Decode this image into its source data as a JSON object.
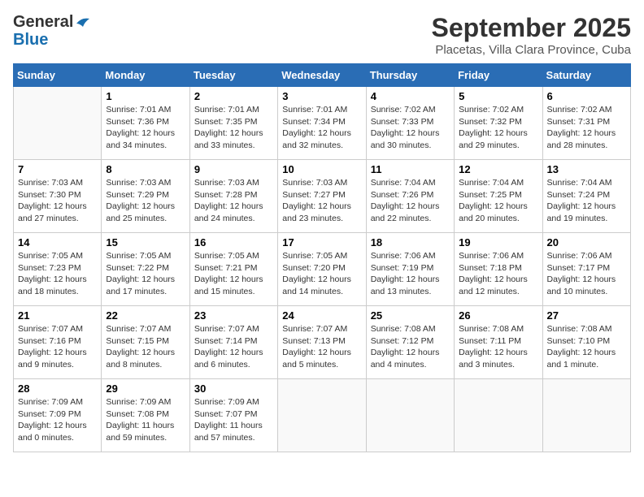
{
  "logo": {
    "general": "General",
    "blue": "Blue"
  },
  "title": "September 2025",
  "subtitle": "Placetas, Villa Clara Province, Cuba",
  "days_of_week": [
    "Sunday",
    "Monday",
    "Tuesday",
    "Wednesday",
    "Thursday",
    "Friday",
    "Saturday"
  ],
  "weeks": [
    [
      {
        "day": "",
        "info": ""
      },
      {
        "day": "1",
        "info": "Sunrise: 7:01 AM\nSunset: 7:36 PM\nDaylight: 12 hours\nand 34 minutes."
      },
      {
        "day": "2",
        "info": "Sunrise: 7:01 AM\nSunset: 7:35 PM\nDaylight: 12 hours\nand 33 minutes."
      },
      {
        "day": "3",
        "info": "Sunrise: 7:01 AM\nSunset: 7:34 PM\nDaylight: 12 hours\nand 32 minutes."
      },
      {
        "day": "4",
        "info": "Sunrise: 7:02 AM\nSunset: 7:33 PM\nDaylight: 12 hours\nand 30 minutes."
      },
      {
        "day": "5",
        "info": "Sunrise: 7:02 AM\nSunset: 7:32 PM\nDaylight: 12 hours\nand 29 minutes."
      },
      {
        "day": "6",
        "info": "Sunrise: 7:02 AM\nSunset: 7:31 PM\nDaylight: 12 hours\nand 28 minutes."
      }
    ],
    [
      {
        "day": "7",
        "info": "Sunrise: 7:03 AM\nSunset: 7:30 PM\nDaylight: 12 hours\nand 27 minutes."
      },
      {
        "day": "8",
        "info": "Sunrise: 7:03 AM\nSunset: 7:29 PM\nDaylight: 12 hours\nand 25 minutes."
      },
      {
        "day": "9",
        "info": "Sunrise: 7:03 AM\nSunset: 7:28 PM\nDaylight: 12 hours\nand 24 minutes."
      },
      {
        "day": "10",
        "info": "Sunrise: 7:03 AM\nSunset: 7:27 PM\nDaylight: 12 hours\nand 23 minutes."
      },
      {
        "day": "11",
        "info": "Sunrise: 7:04 AM\nSunset: 7:26 PM\nDaylight: 12 hours\nand 22 minutes."
      },
      {
        "day": "12",
        "info": "Sunrise: 7:04 AM\nSunset: 7:25 PM\nDaylight: 12 hours\nand 20 minutes."
      },
      {
        "day": "13",
        "info": "Sunrise: 7:04 AM\nSunset: 7:24 PM\nDaylight: 12 hours\nand 19 minutes."
      }
    ],
    [
      {
        "day": "14",
        "info": "Sunrise: 7:05 AM\nSunset: 7:23 PM\nDaylight: 12 hours\nand 18 minutes."
      },
      {
        "day": "15",
        "info": "Sunrise: 7:05 AM\nSunset: 7:22 PM\nDaylight: 12 hours\nand 17 minutes."
      },
      {
        "day": "16",
        "info": "Sunrise: 7:05 AM\nSunset: 7:21 PM\nDaylight: 12 hours\nand 15 minutes."
      },
      {
        "day": "17",
        "info": "Sunrise: 7:05 AM\nSunset: 7:20 PM\nDaylight: 12 hours\nand 14 minutes."
      },
      {
        "day": "18",
        "info": "Sunrise: 7:06 AM\nSunset: 7:19 PM\nDaylight: 12 hours\nand 13 minutes."
      },
      {
        "day": "19",
        "info": "Sunrise: 7:06 AM\nSunset: 7:18 PM\nDaylight: 12 hours\nand 12 minutes."
      },
      {
        "day": "20",
        "info": "Sunrise: 7:06 AM\nSunset: 7:17 PM\nDaylight: 12 hours\nand 10 minutes."
      }
    ],
    [
      {
        "day": "21",
        "info": "Sunrise: 7:07 AM\nSunset: 7:16 PM\nDaylight: 12 hours\nand 9 minutes."
      },
      {
        "day": "22",
        "info": "Sunrise: 7:07 AM\nSunset: 7:15 PM\nDaylight: 12 hours\nand 8 minutes."
      },
      {
        "day": "23",
        "info": "Sunrise: 7:07 AM\nSunset: 7:14 PM\nDaylight: 12 hours\nand 6 minutes."
      },
      {
        "day": "24",
        "info": "Sunrise: 7:07 AM\nSunset: 7:13 PM\nDaylight: 12 hours\nand 5 minutes."
      },
      {
        "day": "25",
        "info": "Sunrise: 7:08 AM\nSunset: 7:12 PM\nDaylight: 12 hours\nand 4 minutes."
      },
      {
        "day": "26",
        "info": "Sunrise: 7:08 AM\nSunset: 7:11 PM\nDaylight: 12 hours\nand 3 minutes."
      },
      {
        "day": "27",
        "info": "Sunrise: 7:08 AM\nSunset: 7:10 PM\nDaylight: 12 hours\nand 1 minute."
      }
    ],
    [
      {
        "day": "28",
        "info": "Sunrise: 7:09 AM\nSunset: 7:09 PM\nDaylight: 12 hours\nand 0 minutes."
      },
      {
        "day": "29",
        "info": "Sunrise: 7:09 AM\nSunset: 7:08 PM\nDaylight: 11 hours\nand 59 minutes."
      },
      {
        "day": "30",
        "info": "Sunrise: 7:09 AM\nSunset: 7:07 PM\nDaylight: 11 hours\nand 57 minutes."
      },
      {
        "day": "",
        "info": ""
      },
      {
        "day": "",
        "info": ""
      },
      {
        "day": "",
        "info": ""
      },
      {
        "day": "",
        "info": ""
      }
    ]
  ]
}
